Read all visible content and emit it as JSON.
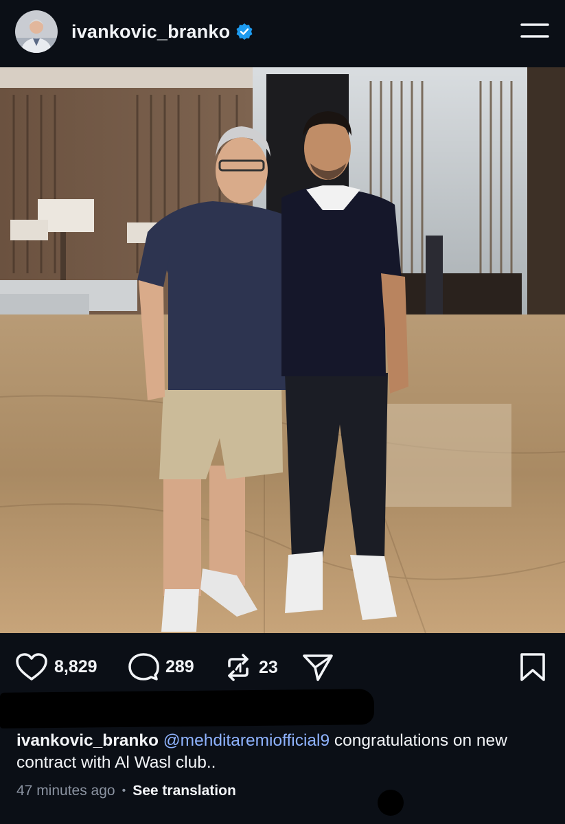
{
  "header": {
    "username": "ivankovic_branko",
    "verified_icon": "verified-badge-icon",
    "menu_icon": "hamburger-menu-icon"
  },
  "photo": {
    "description_icon": "post-photo"
  },
  "actions": {
    "likes": "8,829",
    "comments": "289",
    "reposts": "23",
    "like_icon": "heart-icon",
    "comment_icon": "comment-bubble-icon",
    "repost_icon": "repost-icon",
    "share_icon": "share-paper-plane-icon",
    "bookmark_icon": "bookmark-icon"
  },
  "caption": {
    "username": "ivankovic_branko",
    "mention": "@mehditaremiofficial9",
    "text": "congratulations on new contract with Al Wasl club.."
  },
  "meta": {
    "time": "47 minutes ago",
    "separator": "•",
    "translate": "See translation"
  },
  "colors": {
    "background": "#0b0f16",
    "text": "#f2f4f7",
    "mention": "#8fb3ff",
    "muted": "#8b93a1",
    "verified": "#1d9bf0"
  }
}
